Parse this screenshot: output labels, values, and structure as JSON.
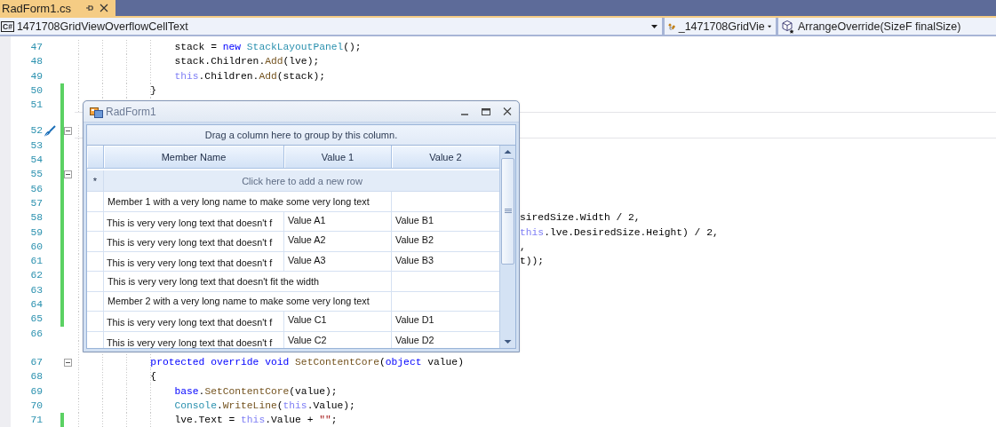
{
  "tab_bar": {
    "tabs": [
      {
        "label": "RadForm1.cs",
        "selected": true
      }
    ]
  },
  "navigation_bar": {
    "project": {
      "badge": "C#",
      "label": "1471708GridViewOverflowCellText"
    },
    "type": "_1471708GridVie",
    "member": "ArrangeOverride(SizeF finalSize)"
  },
  "editor": {
    "lines": [
      {
        "number": "47",
        "changed": false,
        "tokens": [
          {
            "text": "                stack = ",
            "kind": "plain"
          },
          {
            "text": "new",
            "kind": "keyword"
          },
          {
            "text": " StackLayoutPanel",
            "kind": "type"
          },
          {
            "text": "();",
            "kind": "plain"
          }
        ]
      },
      {
        "number": "48",
        "changed": false,
        "tokens": [
          {
            "text": "                stack.Children.",
            "kind": "plain"
          },
          {
            "text": "Add",
            "kind": "method"
          },
          {
            "text": "(lve);",
            "kind": "plain"
          }
        ]
      },
      {
        "number": "49",
        "changed": false,
        "tokens": [
          {
            "text": "                this",
            "kind": "selfref"
          },
          {
            "text": ".Children.",
            "kind": "plain"
          },
          {
            "text": "Add",
            "kind": "method"
          },
          {
            "text": "(stack);",
            "kind": "plain"
          }
        ]
      },
      {
        "number": "50",
        "changed": true,
        "tokens": [
          {
            "text": "            }",
            "kind": "plain"
          }
        ]
      },
      {
        "number": "51",
        "changed": true
      },
      {
        "number": "52",
        "changed": true,
        "current": true,
        "lens_above": true,
        "fold_expanded": true,
        "quick_action": true
      },
      {
        "number": "53",
        "changed": true
      },
      {
        "number": "54",
        "changed": true
      },
      {
        "number": "55",
        "changed": true,
        "fold_expanded": true
      },
      {
        "number": "56",
        "changed": true
      },
      {
        "number": "57",
        "changed": true
      },
      {
        "number": "58",
        "changed": true,
        "tail_only": true,
        "tokens": [
          {
            "text": "siredSize.Width / 2,",
            "kind": "plain"
          }
        ]
      },
      {
        "number": "59",
        "changed": true,
        "tail_only": true,
        "tokens": [
          {
            "text": "this",
            "kind": "selfref"
          },
          {
            "text": ".lve.DesiredSize.Height) / 2,",
            "kind": "plain"
          }
        ]
      },
      {
        "number": "60",
        "changed": true,
        "tail_only": true,
        "tokens": [
          {
            "text": ",",
            "kind": "plain"
          }
        ]
      },
      {
        "number": "61",
        "changed": true,
        "tail_only": true,
        "tokens": [
          {
            "text": "t));",
            "kind": "plain"
          }
        ]
      },
      {
        "number": "62",
        "changed": true
      },
      {
        "number": "63",
        "changed": true
      },
      {
        "number": "64",
        "changed": true
      },
      {
        "number": "65",
        "changed": true
      },
      {
        "number": "66",
        "changed": false
      },
      {
        "number": "67",
        "changed": false,
        "lens_above": true,
        "fold_expanded": true,
        "tokens": [
          {
            "text": "            protected",
            "kind": "keyword"
          },
          {
            "text": " override",
            "kind": "keyword"
          },
          {
            "text": " void",
            "kind": "keyword"
          },
          {
            "text": " SetContentCore",
            "kind": "method"
          },
          {
            "text": "(",
            "kind": "plain"
          },
          {
            "text": "object",
            "kind": "keyword"
          },
          {
            "text": " value)",
            "kind": "plain"
          }
        ]
      },
      {
        "number": "68",
        "changed": false,
        "tokens": [
          {
            "text": "            {",
            "kind": "plain"
          }
        ]
      },
      {
        "number": "69",
        "changed": false,
        "tokens": [
          {
            "text": "                base",
            "kind": "keyword"
          },
          {
            "text": ".",
            "kind": "plain"
          },
          {
            "text": "SetContentCore",
            "kind": "method"
          },
          {
            "text": "(value);",
            "kind": "plain"
          }
        ]
      },
      {
        "number": "70",
        "changed": false,
        "tokens": [
          {
            "text": "                Console",
            "kind": "type"
          },
          {
            "text": ".",
            "kind": "plain"
          },
          {
            "text": "WriteLine",
            "kind": "method"
          },
          {
            "text": "(",
            "kind": "plain"
          },
          {
            "text": "this",
            "kind": "selfref"
          },
          {
            "text": ".Value);",
            "kind": "plain"
          }
        ]
      },
      {
        "number": "71",
        "changed": true,
        "tokens": [
          {
            "text": "                lve.Text = ",
            "kind": "plain"
          },
          {
            "text": "this",
            "kind": "selfref"
          },
          {
            "text": ".Value + ",
            "kind": "plain"
          },
          {
            "text": "\"\"",
            "kind": "string"
          },
          {
            "text": ";",
            "kind": "plain"
          }
        ]
      }
    ]
  },
  "form_window": {
    "title": "RadForm1",
    "group_panel": "Drag a column here to group by this column.",
    "grid": {
      "columns": [
        "Member Name",
        "Value 1",
        "Value 2"
      ],
      "new_row_indicator": "*",
      "new_row": "Click here to add a new row",
      "rows": [
        {
          "member": "Member 1 with a very long name to make some very long text"
        },
        {
          "member": "This is very very long text that doesn't f",
          "value_1": "Value A1",
          "value_2": "Value B1"
        },
        {
          "member": "This is very very long text that doesn't f",
          "value_1": "Value A2",
          "value_2": "Value B2"
        },
        {
          "member": "This is very very long text that doesn't f",
          "value_1": "Value A3",
          "value_2": "Value B3"
        },
        {
          "member": "This is very very long text that doesn't fit the width"
        },
        {
          "member": "Member 2 with a very long name to make some very long text"
        },
        {
          "member": "This is very very long text that doesn't f",
          "value_1": "Value C1",
          "value_2": "Value D1"
        },
        {
          "member": "This is very very long text that doesn't f",
          "value_1": "Value C2",
          "value_2": "Value D2"
        }
      ]
    }
  }
}
